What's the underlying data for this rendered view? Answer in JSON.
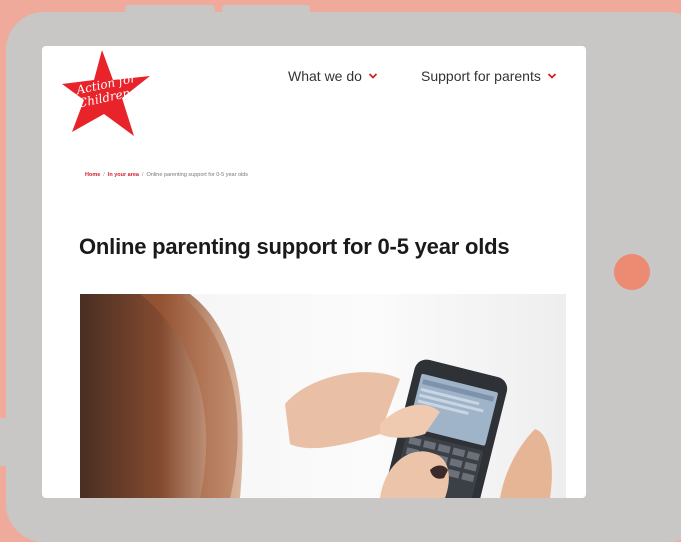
{
  "logo": {
    "text_line1": "Action for",
    "text_line2": "Children",
    "color": "#e8232a"
  },
  "nav": {
    "items": [
      {
        "label": "What we do"
      },
      {
        "label": "Support for parents"
      }
    ],
    "chevron_color": "#d22027"
  },
  "breadcrumb": {
    "items": [
      "Home",
      "In your area",
      "Online parenting support for 0-5 year olds"
    ]
  },
  "page_title": "Online parenting support for 0-5 year olds",
  "hero_image": {
    "icon": "phone-in-hands-photo"
  },
  "colors": {
    "background": "#f0aa9c",
    "frame": "#c9c6c6",
    "accent": "#ec8a72",
    "brand_red": "#d22027"
  }
}
